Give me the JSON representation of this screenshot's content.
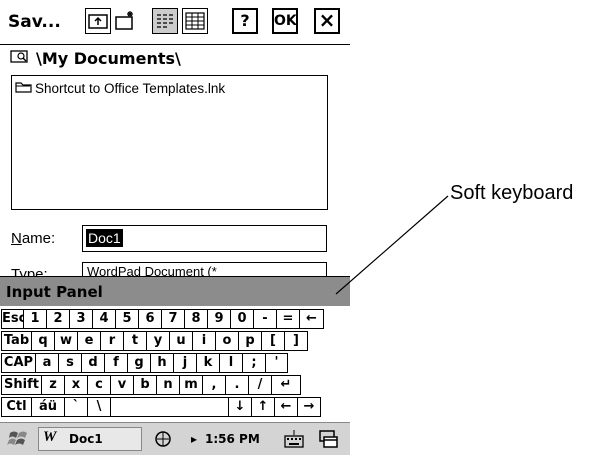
{
  "window": {
    "title": "Sav...",
    "help_label": "?",
    "ok_label": "OK",
    "close_label": "×"
  },
  "path": {
    "text": "\\My Documents\\"
  },
  "files": [
    {
      "name": "Shortcut to Office Templates.lnk"
    }
  ],
  "name_field": {
    "label": "Name:",
    "value": "Doc1"
  },
  "type_field": {
    "label": "Type:",
    "value": "WordPad Document (*"
  },
  "input_panel": {
    "title": "Input Panel"
  },
  "keyboard": {
    "rows": [
      [
        "Esc",
        "1",
        "2",
        "3",
        "4",
        "5",
        "6",
        "7",
        "8",
        "9",
        "0",
        "-",
        "=",
        "←"
      ],
      [
        "Tab",
        "q",
        "w",
        "e",
        "r",
        "t",
        "y",
        "u",
        "i",
        "o",
        "p",
        "[",
        "]"
      ],
      [
        "CAP",
        "a",
        "s",
        "d",
        "f",
        "g",
        "h",
        "j",
        "k",
        "l",
        ";",
        "'"
      ],
      [
        "Shift",
        "z",
        "x",
        "c",
        "v",
        "b",
        "n",
        "m",
        ",",
        ".",
        "/",
        "↵"
      ],
      [
        "Ctl",
        "áü",
        "`",
        "\\",
        " ",
        "↓",
        "↑",
        "←",
        "→"
      ]
    ]
  },
  "taskbar": {
    "app_label": "Doc1",
    "time": "1:56 PM"
  },
  "annotation": {
    "text": "Soft keyboard"
  }
}
